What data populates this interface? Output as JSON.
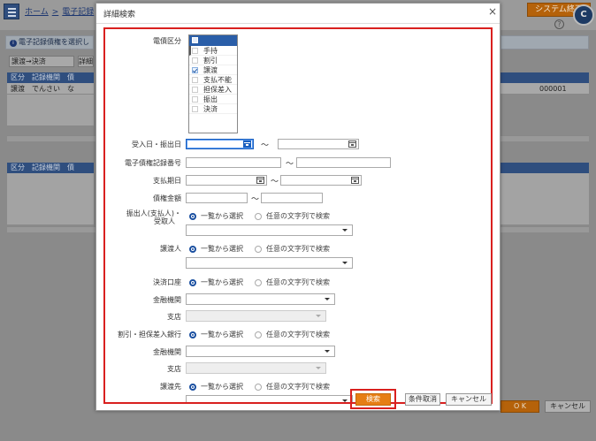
{
  "app": {
    "breadcrumb": [
      "ホーム",
      "電子記録"
    ],
    "system_exit_label": "システム終了",
    "user_initial": "C",
    "help_label": "?",
    "info_text": "電子記録債権を選択し",
    "sort_value": "譲渡→決済",
    "sort_button": "詳細",
    "table1_headers": [
      "区分",
      "記録機関",
      "債"
    ],
    "table1_row": [
      "譲渡",
      "でんさい",
      "な"
    ],
    "table1_right_cell": "000001",
    "table2_headers": [
      "区分",
      "記録機関",
      "債"
    ],
    "footer_ok": "O K",
    "footer_cancel": "キャンセル"
  },
  "dialog": {
    "title": "詳細検索",
    "close_glyph": "×",
    "labels": {
      "saiken_kubun": "電債区分",
      "uke_date": "受入日・振出日",
      "record_no": "電子債権記録番号",
      "due_date": "支払期日",
      "amount": "債権金額",
      "drawer": "振出人(支払人)・",
      "drawer2": "受取人",
      "assignor": "譲渡人",
      "account": "決済口座",
      "bank1": "金融機関",
      "branch1": "支店",
      "discount_bank": "割引・担保差入銀行",
      "bank2": "金融機関",
      "branch2": "支店",
      "assignee": "譲渡先"
    },
    "tilde": "〜",
    "radio_options": [
      "一覧から選択",
      "任意の文字列で検索"
    ],
    "kubun_items": [
      {
        "label": "手持",
        "checked": false
      },
      {
        "label": "割引",
        "checked": false
      },
      {
        "label": "譲渡",
        "checked": true
      },
      {
        "label": "支払不能",
        "checked": false
      },
      {
        "label": "担保差入",
        "checked": false
      },
      {
        "label": "振出",
        "checked": false
      },
      {
        "label": "決済",
        "checked": false
      }
    ],
    "buttons": {
      "search": "検索",
      "clear": "条件取消",
      "cancel": "キャンセル"
    }
  },
  "colors": {
    "accent_orange": "#e67e14",
    "highlight_red": "#d9201f",
    "header_navy": "#2f4e7e"
  }
}
